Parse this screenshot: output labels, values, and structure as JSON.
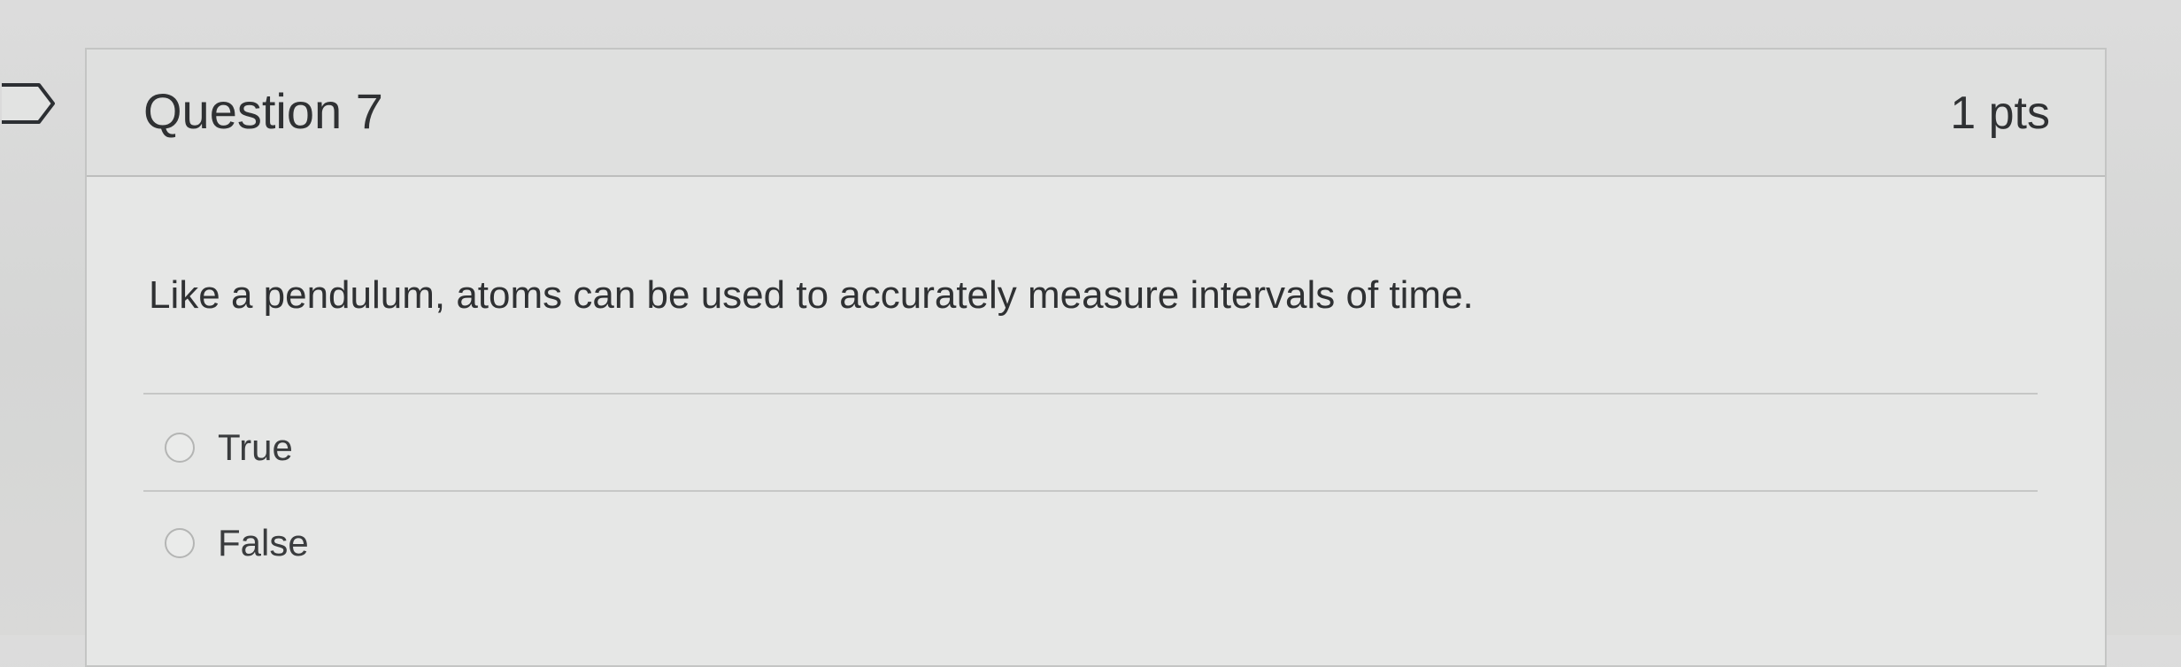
{
  "question": {
    "title": "Question 7",
    "points": "1 pts",
    "text": "Like a pendulum, atoms can be used to accurately measure intervals of time."
  },
  "answers": [
    {
      "label": "True",
      "selected": false
    },
    {
      "label": "False",
      "selected": false
    }
  ],
  "icons": {
    "flag": "flag-question-icon",
    "radio": "radio-circle-icon"
  },
  "colors": {
    "page_background": "#d8d8d8",
    "card_background": "#e6e7e6",
    "header_background": "#dfe0df",
    "text": "#2f3133",
    "border": "#c4c5c4"
  }
}
